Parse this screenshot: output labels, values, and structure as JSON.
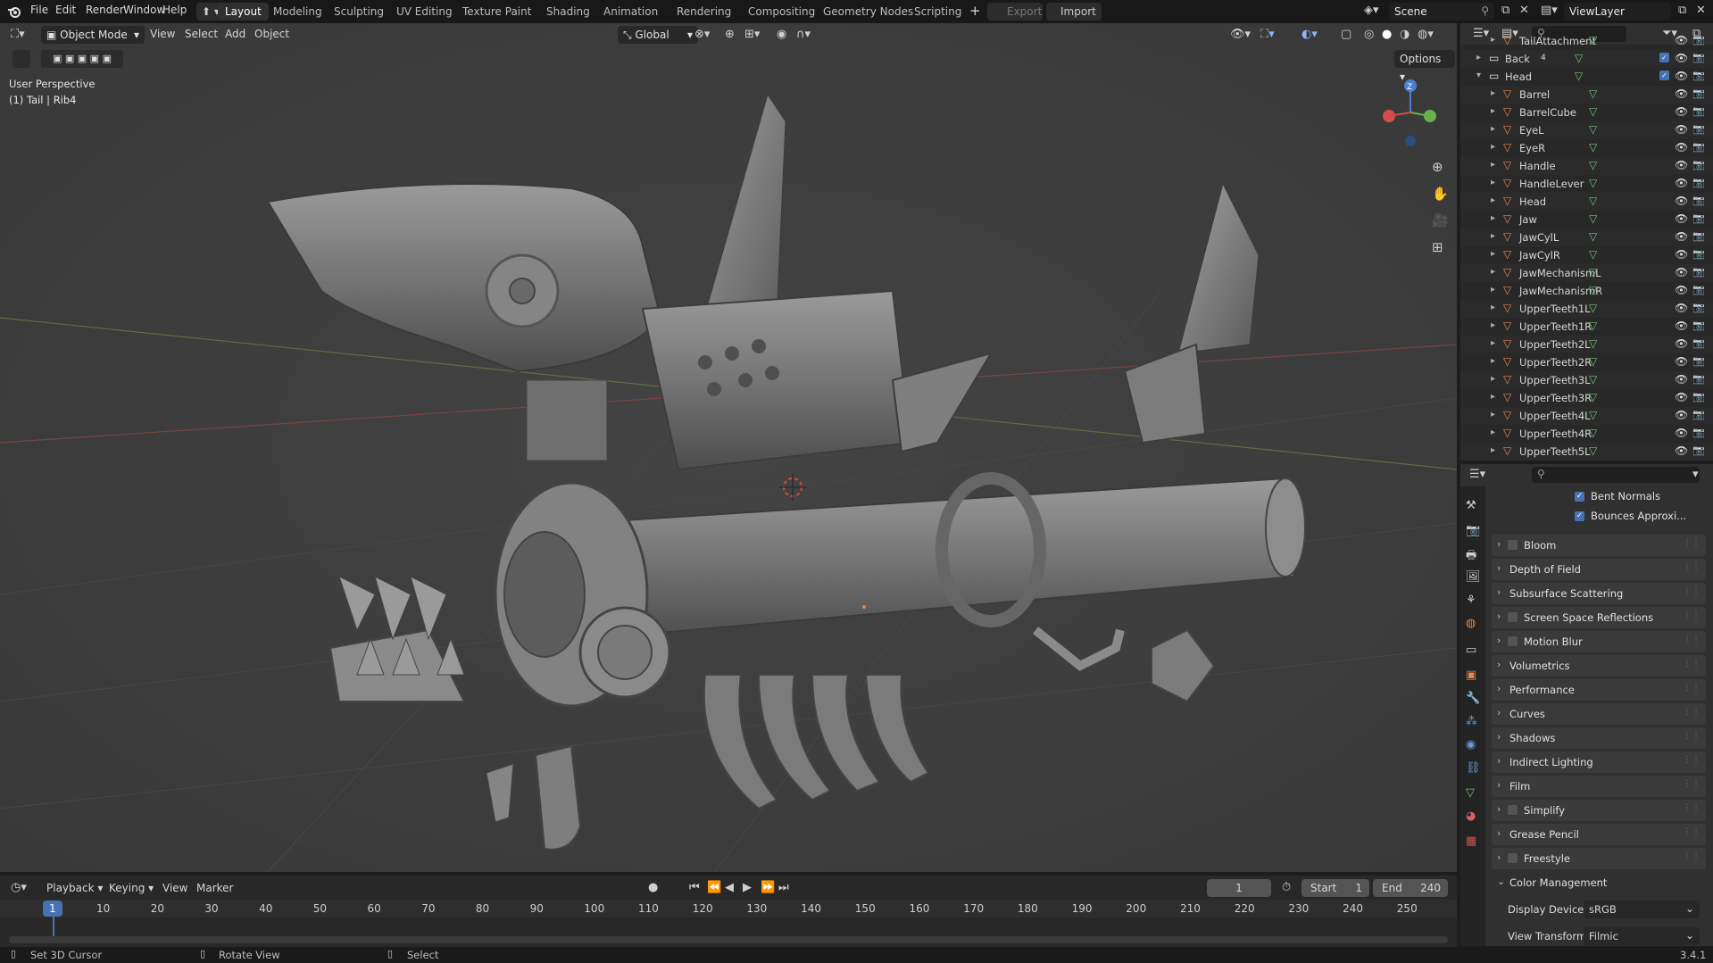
{
  "topbar": {
    "menus": [
      "File",
      "Edit",
      "Render",
      "Window",
      "Help"
    ],
    "workspaces": [
      "Layout",
      "Modeling",
      "Sculpting",
      "UV Editing",
      "Texture Paint",
      "Shading",
      "Animation",
      "Rendering",
      "Compositing",
      "Geometry Nodes",
      "Scripting"
    ],
    "active_workspace": "Layout",
    "export_label": "Export",
    "import_label": "Import",
    "scene_name": "Scene",
    "view_layer": "ViewLayer"
  },
  "viewport": {
    "mode": "Object Mode",
    "menus": [
      "View",
      "Select",
      "Add",
      "Object"
    ],
    "transform_orientation": "Global",
    "options_label": "Options",
    "perspective_label": "User Perspective",
    "selection_label": "(1) Tail | Rib4",
    "gizmo_axis": "Z"
  },
  "outliner": {
    "rows": [
      {
        "name": "TailAttachment",
        "type": "object",
        "indent": 2
      },
      {
        "name": "Back",
        "type": "collection",
        "indent": 1,
        "badge": "4"
      },
      {
        "name": "Head",
        "type": "collection",
        "indent": 1
      },
      {
        "name": "Barrel",
        "type": "object",
        "indent": 2
      },
      {
        "name": "BarrelCube",
        "type": "object",
        "indent": 2
      },
      {
        "name": "EyeL",
        "type": "object",
        "indent": 2
      },
      {
        "name": "EyeR",
        "type": "object",
        "indent": 2
      },
      {
        "name": "Handle",
        "type": "object",
        "indent": 2
      },
      {
        "name": "HandleLever",
        "type": "object",
        "indent": 2
      },
      {
        "name": "Head",
        "type": "object",
        "indent": 2
      },
      {
        "name": "Jaw",
        "type": "object",
        "indent": 2
      },
      {
        "name": "JawCylL",
        "type": "object",
        "indent": 2
      },
      {
        "name": "JawCylR",
        "type": "object",
        "indent": 2
      },
      {
        "name": "JawMechanismL",
        "type": "object",
        "indent": 2
      },
      {
        "name": "JawMechanismR",
        "type": "object",
        "indent": 2
      },
      {
        "name": "UpperTeeth1L",
        "type": "object",
        "indent": 2
      },
      {
        "name": "UpperTeeth1R",
        "type": "object",
        "indent": 2
      },
      {
        "name": "UpperTeeth2L",
        "type": "object",
        "indent": 2
      },
      {
        "name": "UpperTeeth2R",
        "type": "object",
        "indent": 2
      },
      {
        "name": "UpperTeeth3L",
        "type": "object",
        "indent": 2
      },
      {
        "name": "UpperTeeth3R",
        "type": "object",
        "indent": 2
      },
      {
        "name": "UpperTeeth4L",
        "type": "object",
        "indent": 2
      },
      {
        "name": "UpperTeeth4R",
        "type": "object",
        "indent": 2
      },
      {
        "name": "UpperTeeth5L",
        "type": "object",
        "indent": 2
      }
    ]
  },
  "properties": {
    "checks": [
      {
        "label": "Bent Normals",
        "checked": true
      },
      {
        "label": "Bounces Approxi...",
        "checked": true
      }
    ],
    "panels": [
      {
        "label": "Bloom",
        "checkbox": true
      },
      {
        "label": "Depth of Field",
        "checkbox": false
      },
      {
        "label": "Subsurface Scattering",
        "checkbox": false
      },
      {
        "label": "Screen Space Reflections",
        "checkbox": true
      },
      {
        "label": "Motion Blur",
        "checkbox": true
      },
      {
        "label": "Volumetrics",
        "checkbox": false
      },
      {
        "label": "Performance",
        "checkbox": false
      },
      {
        "label": "Curves",
        "checkbox": false
      },
      {
        "label": "Shadows",
        "checkbox": false
      },
      {
        "label": "Indirect Lighting",
        "checkbox": false
      },
      {
        "label": "Film",
        "checkbox": false
      },
      {
        "label": "Simplify",
        "checkbox": true
      },
      {
        "label": "Grease Pencil",
        "checkbox": false
      },
      {
        "label": "Freestyle",
        "checkbox": true
      }
    ],
    "color_management": {
      "title": "Color Management",
      "display_device_label": "Display Device",
      "display_device_value": "sRGB",
      "view_transform_label": "View Transform",
      "view_transform_value": "Filmic"
    }
  },
  "timeline": {
    "menus": [
      "Playback",
      "Keying",
      "View",
      "Marker"
    ],
    "current_frame": "1",
    "start_label": "Start",
    "start_value": "1",
    "end_label": "End",
    "end_value": "240",
    "ticks": [
      "1",
      "10",
      "20",
      "30",
      "40",
      "50",
      "60",
      "70",
      "80",
      "90",
      "100",
      "110",
      "120",
      "130",
      "140",
      "150",
      "160",
      "170",
      "180",
      "190",
      "200",
      "210",
      "220",
      "230",
      "240",
      "250"
    ]
  },
  "statusbar": {
    "hints": [
      "Set 3D Cursor",
      "Rotate View",
      "Select"
    ],
    "version": "3.4.1"
  },
  "colors": {
    "accent": "#4772b3",
    "mesh_icon": "#e8854a",
    "data_icon": "#6ec47a"
  }
}
